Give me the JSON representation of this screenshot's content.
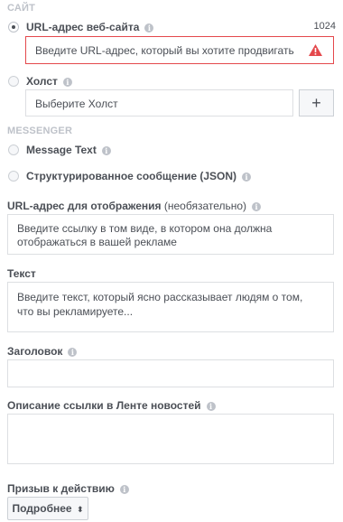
{
  "site": {
    "section_title": "САЙТ",
    "url_label": "URL-адрес веб-сайта",
    "char_count": "1024",
    "url_placeholder": "Введите URL-адрес, который вы хотите продвигать"
  },
  "canvas": {
    "label": "Холст",
    "placeholder": "Выберите Холст",
    "add_button": "+"
  },
  "messenger": {
    "section_title": "MESSENGER",
    "message_text_label": "Message Text",
    "structured_label": "Структурированное сообщение (JSON)"
  },
  "display_url": {
    "label": "URL-адрес для отображения",
    "label_suffix": "(необязательно)",
    "placeholder": "Введите ссылку в том виде, в котором она должна отображаться в вашей рекламе"
  },
  "text": {
    "label": "Текст",
    "placeholder": "Введите текст, который ясно рассказывает людям о том, что вы рекламируете..."
  },
  "headline": {
    "label": "Заголовок"
  },
  "news_feed_description": {
    "label": "Описание ссылки в Ленте новостей"
  },
  "cta": {
    "label": "Призыв к действию",
    "selected": "Подробнее",
    "arrow": "⬍"
  },
  "colors": {
    "error": "#e4484c",
    "section_title": "#bec2c9",
    "border": "#dddfe2"
  }
}
